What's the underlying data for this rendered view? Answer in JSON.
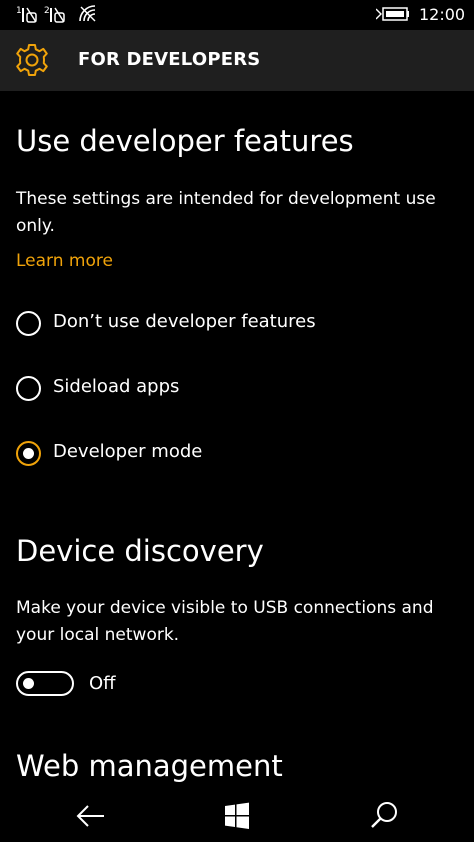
{
  "status_bar": {
    "sim1_label": "1",
    "sim2_label": "2",
    "time": "12:00"
  },
  "header": {
    "title": "FOR DEVELOPERS",
    "icon": "gear-icon",
    "accent_color": "#f0a30a"
  },
  "developer_features": {
    "heading": "Use developer features",
    "description": "These settings are intended for development use only.",
    "learn_more": "Learn more",
    "options": [
      {
        "label": "Don’t use developer features",
        "selected": false
      },
      {
        "label": "Sideload apps",
        "selected": false
      },
      {
        "label": "Developer mode",
        "selected": true
      }
    ]
  },
  "device_discovery": {
    "heading": "Device discovery",
    "description": "Make your device visible to USB connections and your local network.",
    "toggle_state": "Off"
  },
  "web_management": {
    "heading": "Web management"
  },
  "nav_bar": {
    "back": "back-arrow-icon",
    "start": "windows-logo-icon",
    "search": "search-icon"
  }
}
